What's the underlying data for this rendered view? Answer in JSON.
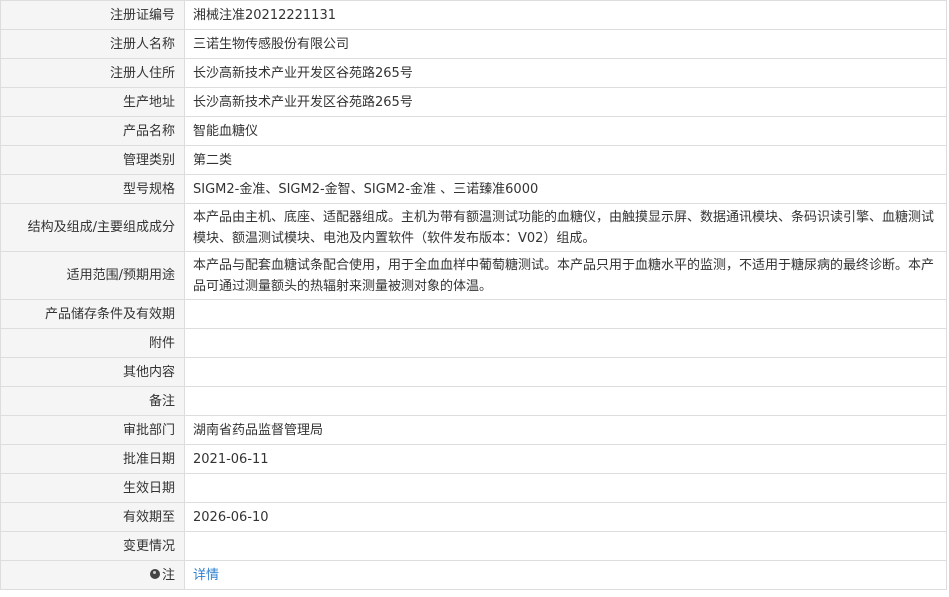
{
  "rows": [
    {
      "label": "注册证编号",
      "value": "湘械注准20212221131"
    },
    {
      "label": "注册人名称",
      "value": "三诺生物传感股份有限公司"
    },
    {
      "label": "注册人住所",
      "value": "长沙高新技术产业开发区谷苑路265号"
    },
    {
      "label": "生产地址",
      "value": "长沙高新技术产业开发区谷苑路265号"
    },
    {
      "label": "产品名称",
      "value": "智能血糖仪"
    },
    {
      "label": "管理类别",
      "value": "第二类"
    },
    {
      "label": "型号规格",
      "value": "SIGM2-金准、SIGM2-金智、SIGM2-金准 、三诺臻准6000"
    },
    {
      "label": "结构及组成/主要组成成分",
      "value": "本产品由主机、底座、适配器组成。主机为带有额温测试功能的血糖仪，由触摸显示屏、数据通讯模块、条码识读引擎、血糖测试模块、额温测试模块、电池及内置软件（软件发布版本：V02）组成。"
    },
    {
      "label": "适用范围/预期用途",
      "value": "本产品与配套血糖试条配合使用，用于全血血样中葡萄糖测试。本产品只用于血糖水平的监测，不适用于糖尿病的最终诊断。本产品可通过测量额头的热辐射来测量被测对象的体温。"
    },
    {
      "label": "产品储存条件及有效期",
      "value": ""
    },
    {
      "label": "附件",
      "value": ""
    },
    {
      "label": "其他内容",
      "value": ""
    },
    {
      "label": "备注",
      "value": ""
    },
    {
      "label": "审批部门",
      "value": "湖南省药品监督管理局"
    },
    {
      "label": "批准日期",
      "value": "2021-06-11"
    },
    {
      "label": "生效日期",
      "value": ""
    },
    {
      "label": "有效期至",
      "value": "2026-06-10"
    },
    {
      "label": "变更情况",
      "value": ""
    }
  ],
  "note": {
    "label": "注",
    "icon": "note-icon",
    "link_text": "详情",
    "link_color": "#2f7fd0"
  }
}
